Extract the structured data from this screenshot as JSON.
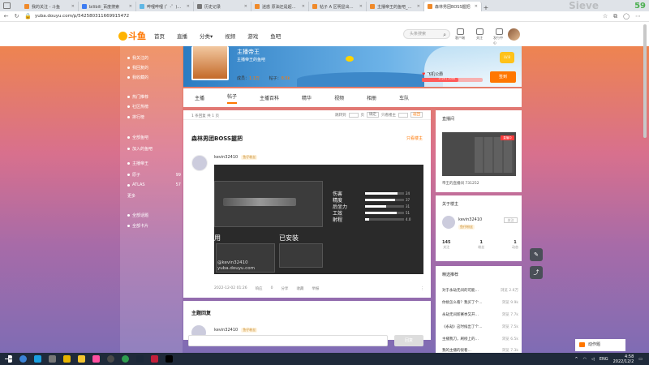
{
  "browser": {
    "tabs": [
      {
        "title": "我的关注 - 斗鱼",
        "active": false
      },
      {
        "title": "bilibili_百度搜索",
        "active": false
      },
      {
        "title": "哔哩哔哩 (゜-゜)つロ 干杯~",
        "active": false
      },
      {
        "title": "历史记录",
        "active": false
      },
      {
        "title": "迷惑 原油还是超神中科Haul",
        "active": false
      },
      {
        "title": "帖子 A 区明显出现在",
        "active": false
      },
      {
        "title": "主播帝王的鱼吧_斗鱼鱼吧",
        "active": false
      },
      {
        "title": "森林男团BOSS握把",
        "active": true
      }
    ],
    "new_tab": "+",
    "url": "yuba.douyu.com/p/542580311669915472",
    "overlay_watermark": "Sieve",
    "overlay_number": "59"
  },
  "header": {
    "logo": "斗鱼",
    "nav": [
      "首页",
      "直播",
      "分类▾",
      "视频",
      "游戏",
      "鱼吧"
    ],
    "search_placeholder": "头条搜索",
    "icons": [
      {
        "name": "history-icon",
        "label": "客户端"
      },
      {
        "name": "follow-icon",
        "label": "关注"
      },
      {
        "name": "message-icon",
        "label": "发行中心"
      }
    ]
  },
  "sidebar": {
    "items": [
      {
        "label": "我关注的",
        "count": ""
      },
      {
        "label": "我回复的",
        "count": ""
      },
      {
        "label": "我收藏的",
        "count": ""
      },
      {
        "label": "热门推荐",
        "count": ""
      },
      {
        "label": "社区热榜",
        "count": ""
      },
      {
        "label": "排行榜",
        "count": ""
      },
      {
        "label": "全部鱼吧",
        "count": ""
      },
      {
        "label": "加入的鱼吧",
        "count": ""
      },
      {
        "label": "主播帝王",
        "count": ""
      },
      {
        "label": "原子",
        "count": "99"
      },
      {
        "label": "ATLAS",
        "count": "57"
      },
      {
        "label": "更多",
        "count": ""
      },
      {
        "label": "全部话题",
        "count": ""
      },
      {
        "label": "全部卡片",
        "count": ""
      }
    ]
  },
  "banner": {
    "title": "主播帝王",
    "subtitle": "主播帝王的鱼吧",
    "members_label": "成员：",
    "members_value": "1.1万",
    "posts_label": "帖子：",
    "posts_value": "8.5k",
    "level_badge": "LV.8",
    "exp_label": "飞机公爵",
    "exp_text": "1724 / 2000",
    "exp_progress": 0.6,
    "sign_button": "签到"
  },
  "tabs": [
    "主播",
    "帖子",
    "主播百科",
    "精华",
    "视频",
    "相册",
    "车队"
  ],
  "active_tab": "帖子",
  "post": {
    "toolbar_left": "1 条回复 共 1 页",
    "toolbar_jump": "跳转到",
    "toolbar_page": "页",
    "toolbar_go": "确定",
    "toolbar_author_only": "只看楼主",
    "toolbar_back": "返回",
    "title": "森林男团BOSS握把",
    "hide_link": "只看楼主",
    "author": "kevin32410",
    "author_tag": "鱼仔粉丝",
    "shot": {
      "stats": [
        {
          "label": "伤害",
          "value": 0.84,
          "num": "24"
        },
        {
          "label": "精度",
          "value": 0.78,
          "num": "37"
        },
        {
          "label": "后坐力",
          "value": 0.55,
          "num": "31"
        },
        {
          "label": "工效",
          "value": 0.82,
          "num": "51"
        },
        {
          "label": "射程",
          "value": 0.1,
          "num": "4.0"
        }
      ],
      "use_label": "用",
      "equip_label": "已安装",
      "watermark_1": "@kevin32410",
      "watermark_2": "yuba.douyu.com"
    },
    "meta": [
      "2022-12-02 01:26",
      "响应",
      "0",
      "分享",
      "收藏",
      "举报"
    ],
    "more": "⋮"
  },
  "reply": {
    "title": "主题回复",
    "user": "kevin32410",
    "user_tag": "鱼仔粉丝",
    "submit": "回复"
  },
  "right": {
    "live_title": "直播间",
    "live_flag": "直播中",
    "live_caption": "帝王的直播间 731252",
    "owner_title": "关于楼主",
    "owner_name": "kevin32410",
    "owner_tag": "鱼仔粉丝",
    "owner_follow": "关注",
    "owner_stats": [
      {
        "value": "145",
        "label": "关注"
      },
      {
        "value": "1",
        "label": "粉丝"
      },
      {
        "value": "1",
        "label": "动态"
      }
    ],
    "rec_title": "精选推荐",
    "rec_items": [
      {
        "title": "对于永劫无间的可能…",
        "views": "浏览 2.6万"
      },
      {
        "title": "你搞怎么看？我买了个…",
        "views": "浏览 9.9k"
      },
      {
        "title": "永劫无间新赛季又开…",
        "views": "浏览 7.7k"
      },
      {
        "title": "《永劫》这时候出了个…",
        "views": "浏览 7.5k"
      },
      {
        "title": "主播我刀，刷榜上的…",
        "views": "浏览 6.5k"
      },
      {
        "title": "我的主播的很看…",
        "views": "浏览 7.3k"
      }
    ]
  },
  "notice": "动作题",
  "taskbar": {
    "lang": "ENG",
    "time": "4:58",
    "date": "2022/12/2"
  }
}
